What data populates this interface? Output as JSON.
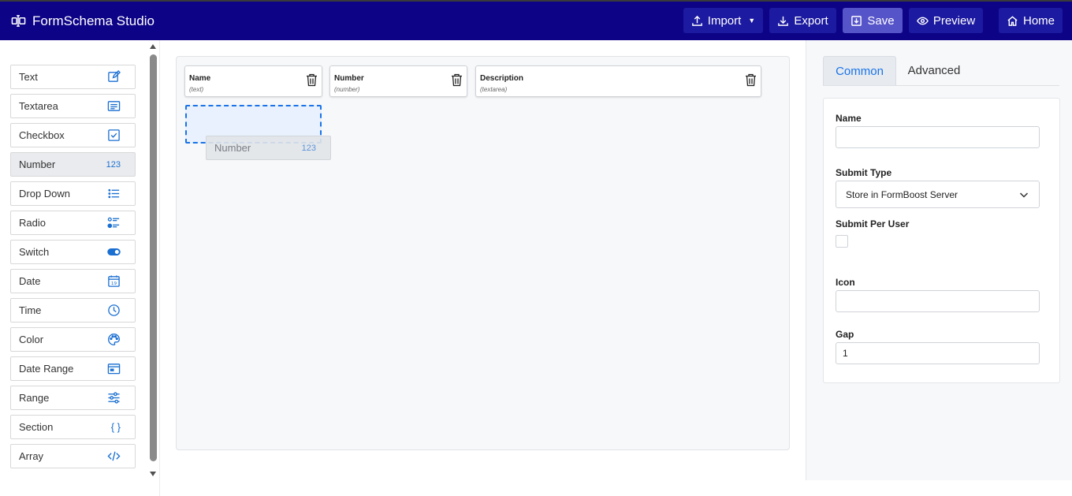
{
  "app": {
    "title": "FormSchema Studio"
  },
  "toolbar": {
    "import_label": "Import",
    "export_label": "Export",
    "save_label": "Save",
    "preview_label": "Preview",
    "home_label": "Home"
  },
  "palette": {
    "items": [
      {
        "label": "Text",
        "icon": "edit-icon"
      },
      {
        "label": "Textarea",
        "icon": "textarea-icon"
      },
      {
        "label": "Checkbox",
        "icon": "checkbox-icon"
      },
      {
        "label": "Number",
        "icon": "number-icon",
        "icon_text": "123"
      },
      {
        "label": "Drop Down",
        "icon": "list-icon"
      },
      {
        "label": "Radio",
        "icon": "radio-list-icon"
      },
      {
        "label": "Switch",
        "icon": "toggle-icon"
      },
      {
        "label": "Date",
        "icon": "calendar-icon",
        "icon_text": "19"
      },
      {
        "label": "Time",
        "icon": "clock-icon"
      },
      {
        "label": "Color",
        "icon": "palette-icon"
      },
      {
        "label": "Date Range",
        "icon": "date-range-icon"
      },
      {
        "label": "Range",
        "icon": "sliders-icon"
      },
      {
        "label": "Section",
        "icon": "braces-icon",
        "icon_text": "{ }"
      },
      {
        "label": "Array",
        "icon": "code-icon"
      }
    ]
  },
  "canvas": {
    "fields": [
      {
        "name": "Name",
        "type": "(text)"
      },
      {
        "name": "Number",
        "type": "(number)"
      },
      {
        "name": "Description",
        "type": "(textarea)"
      }
    ],
    "drag_ghost": {
      "label": "Number",
      "icon_text": "123"
    }
  },
  "properties": {
    "tabs": [
      "Common",
      "Advanced"
    ],
    "name_label": "Name",
    "name_value": "",
    "submit_type_label": "Submit Type",
    "submit_type_value": "Store in FormBoost Server",
    "submit_per_user_label": "Submit Per User",
    "submit_per_user_checked": false,
    "icon_label": "Icon",
    "icon_value": "",
    "gap_label": "Gap",
    "gap_value": "1"
  },
  "colors": {
    "header_bg": "#0d0386",
    "accent": "#1a73e8"
  }
}
